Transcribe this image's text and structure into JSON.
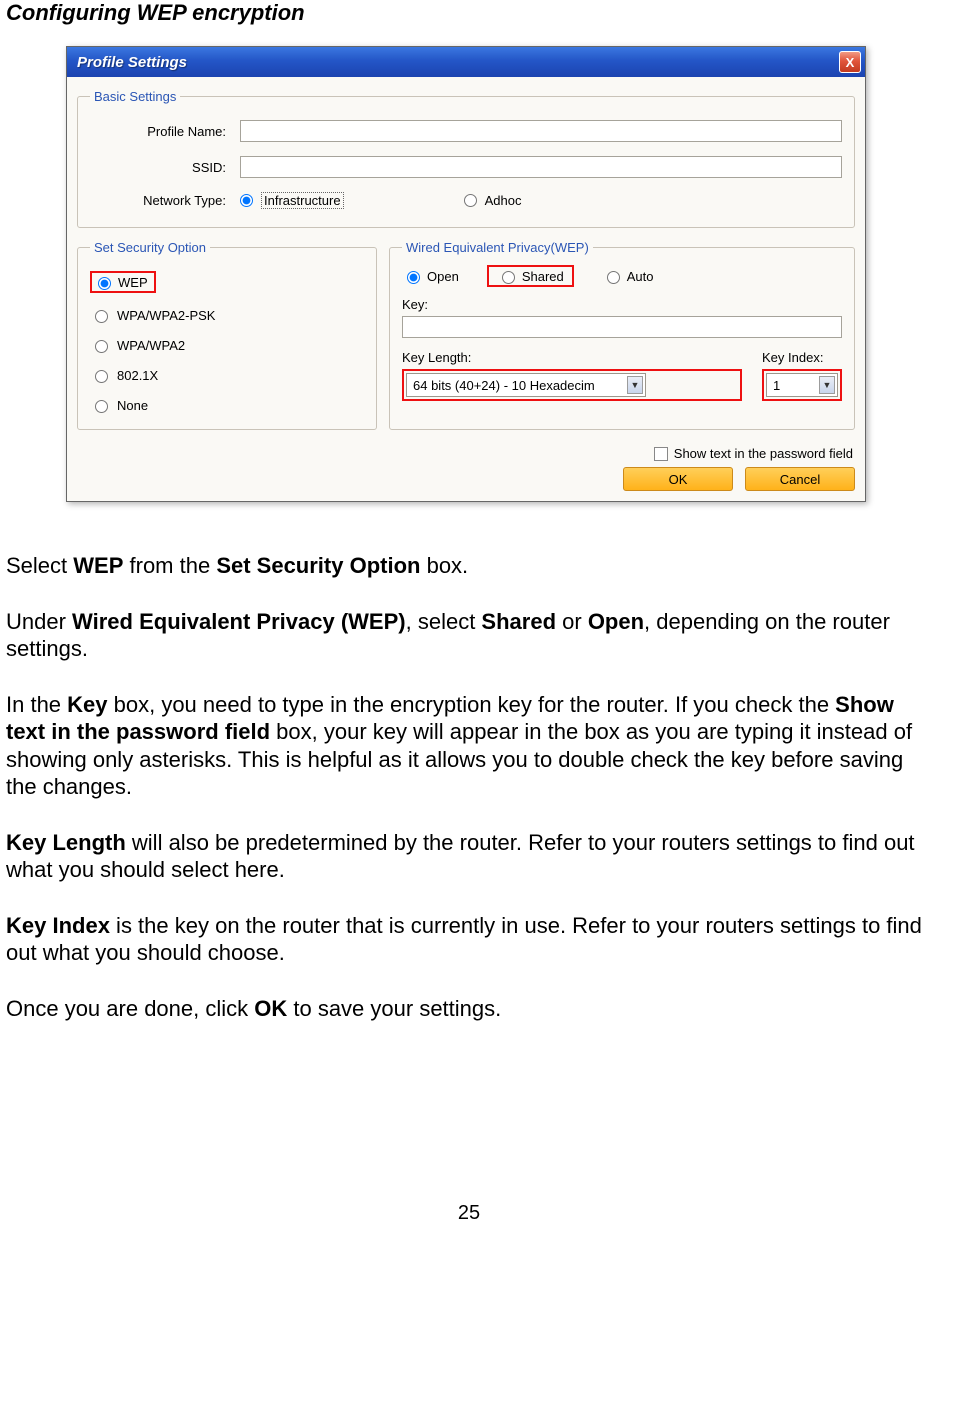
{
  "heading": "Configuring WEP encryption",
  "dialog": {
    "title": "Profile Settings",
    "close": "X",
    "basic": {
      "legend": "Basic Settings",
      "profile_name_label": "Profile Name:",
      "profile_name_value": "",
      "ssid_label": "SSID:",
      "ssid_value": "",
      "net_type_label": "Network Type:",
      "net_type_infra": "Infrastructure",
      "net_type_adhoc": "Adhoc"
    },
    "security": {
      "legend": "Set Security Option",
      "options": [
        "WEP",
        "WPA/WPA2-PSK",
        "WPA/WPA2",
        "802.1X",
        "None"
      ]
    },
    "wep": {
      "legend": "Wired Equivalent Privacy(WEP)",
      "open": "Open",
      "shared": "Shared",
      "auto": "Auto",
      "key_label": "Key:",
      "key_value": "",
      "key_length_label": "Key Length:",
      "key_length_value": "64 bits (40+24) - 10 Hexadecim",
      "key_index_label": "Key Index:",
      "key_index_value": "1",
      "show_text": "Show text in the password field"
    },
    "ok": "OK",
    "cancel": "Cancel"
  },
  "para": {
    "p1a": "Select ",
    "p1b": "WEP",
    "p1c": " from the ",
    "p1d": "Set Security Option",
    "p1e": " box.",
    "p2a": "Under ",
    "p2b": "Wired Equivalent Privacy (WEP)",
    "p2c": ", select ",
    "p2d": "Shared",
    "p2e": " or ",
    "p2f": "Open",
    "p2g": ", depending on the router settings.",
    "p3a": "In the ",
    "p3b": "Key",
    "p3c": " box, you need to type in the encryption key for the router.  If you check the ",
    "p3d": "Show text in the password field",
    "p3e": " box, your key will appear in the box as you are typing it instead of showing only asterisks.  This is helpful as it allows you to double check the key before saving the changes.",
    "p4a": "Key Length",
    "p4b": " will also be predetermined by the router.  Refer to your routers settings to find out what you should select here.",
    "p5a": "Key Index",
    "p5b": " is the key on the router that is currently in use.  Refer to your routers settings to find out what you should choose.",
    "p6a": "Once you are done, click ",
    "p6b": "OK",
    "p6c": " to save your settings."
  },
  "page_number": "25"
}
